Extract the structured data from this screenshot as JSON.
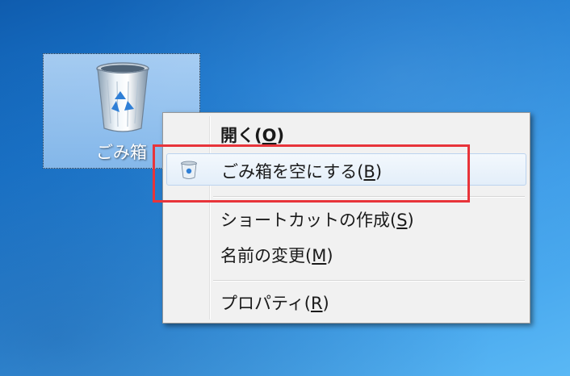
{
  "desktop": {
    "recycle_bin_label": "ごみ箱"
  },
  "context_menu": {
    "items": [
      {
        "text": "開く",
        "accel_open": "(",
        "accel_key": "O",
        "accel_close": ")"
      },
      {
        "text": "ごみ箱を空にする",
        "accel_open": "(",
        "accel_key": "B",
        "accel_close": ")"
      },
      {
        "text": "ショートカットの作成",
        "accel_open": "(",
        "accel_key": "S",
        "accel_close": ")"
      },
      {
        "text": "名前の変更",
        "accel_open": "(",
        "accel_key": "M",
        "accel_close": ")"
      },
      {
        "text": "プロパティ",
        "accel_open": "(",
        "accel_key": "R",
        "accel_close": ")"
      }
    ]
  },
  "annotation": {
    "highlight_color": "#e8343a"
  }
}
